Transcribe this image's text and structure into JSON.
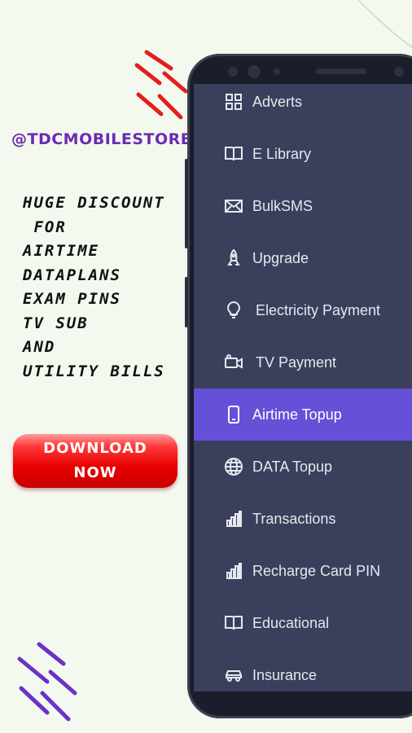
{
  "handle": "@TDCMOBILESTORE",
  "promo_lines": [
    "HUGE DISCOUNT",
    " FOR",
    "AIRTIME",
    "DATAPLANS",
    "EXAM PINS",
    "TV SUB",
    "AND",
    "UTILITY BILLS"
  ],
  "download": {
    "line1": "DOWNLOAD",
    "line2": "NOW"
  },
  "menu": [
    {
      "label": "Adverts",
      "icon": "grid-icon"
    },
    {
      "label": "E Library",
      "icon": "book-icon"
    },
    {
      "label": "BulkSMS",
      "icon": "envelope-icon"
    },
    {
      "label": "Upgrade",
      "icon": "rocket-icon"
    },
    {
      "label": "Electricity Payment",
      "icon": "lightbulb-icon"
    },
    {
      "label": "TV Payment",
      "icon": "video-camera-icon"
    },
    {
      "label": "Airtime Topup",
      "icon": "mobile-phone-icon",
      "active": true
    },
    {
      "label": "DATA Topup",
      "icon": "globe-icon"
    },
    {
      "label": "Transactions",
      "icon": "bar-chart-icon"
    },
    {
      "label": "Recharge Card PIN",
      "icon": "bar-chart-icon"
    },
    {
      "label": "Educational",
      "icon": "book-icon"
    },
    {
      "label": "Insurance",
      "icon": "car-icon"
    }
  ],
  "colors": {
    "accent": "#6451d8",
    "drawer_bg": "#3a3f5c",
    "handle": "#6a2bb3",
    "button_red": "#e90000",
    "page_bg": "#f3f9ef"
  }
}
